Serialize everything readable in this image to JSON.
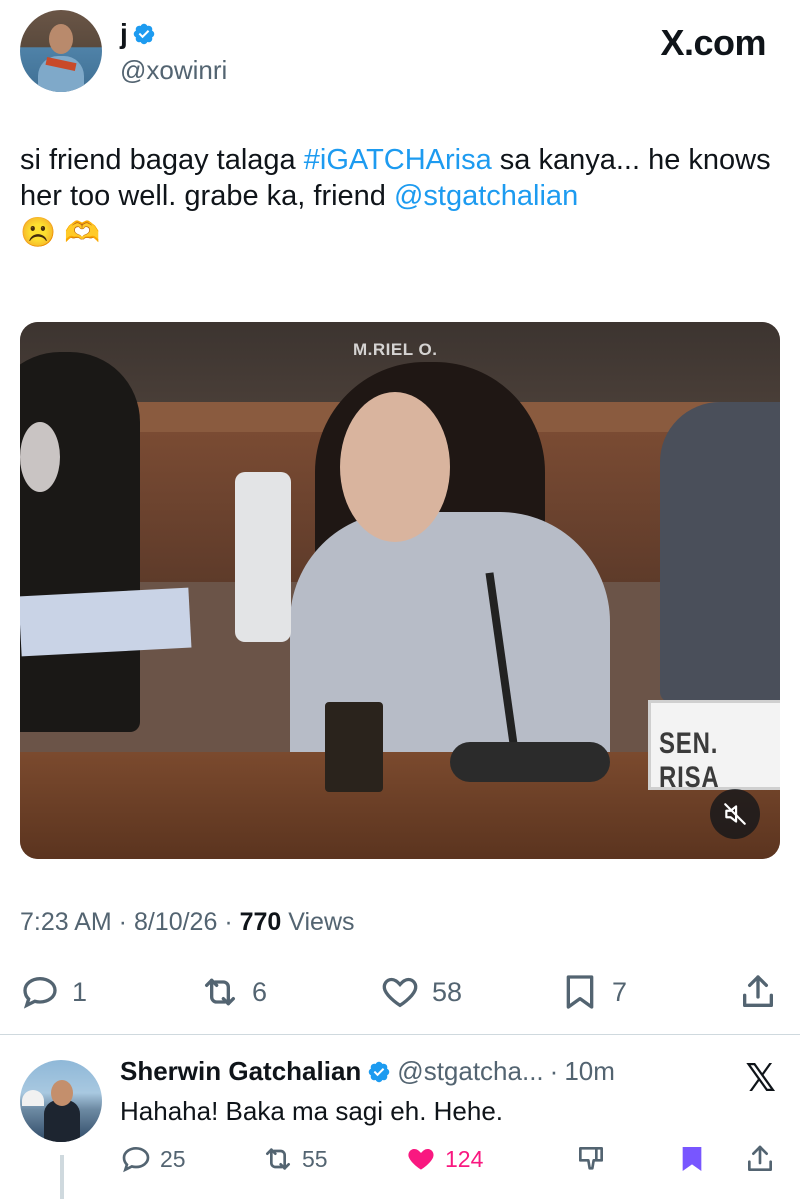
{
  "tweet": {
    "author": {
      "name": "j",
      "handle": "@xowinri",
      "verified": true
    },
    "site": "X.com",
    "text_parts": [
      {
        "text": "si friend bagay talaga ",
        "link": false
      },
      {
        "text": "#iGATCHArisa",
        "link": true
      },
      {
        "text": " sa kanya... he knows her too well. grabe ka, friend ",
        "link": false
      },
      {
        "text": "@stgatchalian",
        "link": true
      }
    ],
    "emojis": [
      "☹️",
      "🫶"
    ],
    "media": {
      "watermark": "M.RIEL O.",
      "nameplate": "SEN. RISA",
      "muted": true
    },
    "time": "7:23 AM",
    "date": "8/10/26",
    "views_count": "770",
    "views_label": "Views",
    "replies": "1",
    "reposts": "6",
    "likes": "58",
    "bookmarks": "7"
  },
  "reply": {
    "name": "Sherwin Gatchalian",
    "handle": "@stgatcha...",
    "separator": "·",
    "age": "10m",
    "verified": true,
    "text": "Hahaha! Baka ma sagi eh. Hehe.",
    "replies": "25",
    "reposts": "55",
    "likes": "124",
    "liked": true,
    "bookmarked": true
  },
  "colors": {
    "link": "#1d9bf0",
    "like": "#f91880",
    "bookmark": "#7856ff",
    "muted": "#536471"
  }
}
